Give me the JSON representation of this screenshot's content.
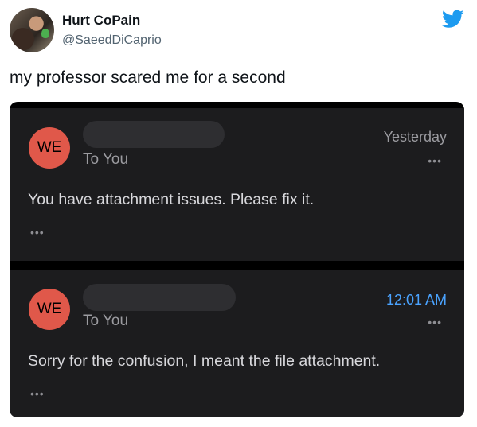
{
  "tweet": {
    "display_name": "Hurt CoPain",
    "handle": "@SaeedDiCaprio",
    "text": "my professor scared me for a second",
    "brand_color": "#1d9bf0"
  },
  "emails": [
    {
      "sender_initials": "WE",
      "to_label": "To You",
      "time": "Yesterday",
      "body": "You have attachment issues. Please fix it.",
      "more_right": "•••",
      "more_left": "•••"
    },
    {
      "sender_initials": "WE",
      "to_label": "To You",
      "time": "12:01 AM",
      "body": "Sorry for the confusion, I meant the file attachment.",
      "more_right": "•••",
      "more_left": "•••"
    }
  ],
  "icons": [
    "twitter-bird-icon",
    "more-dots-icon"
  ]
}
